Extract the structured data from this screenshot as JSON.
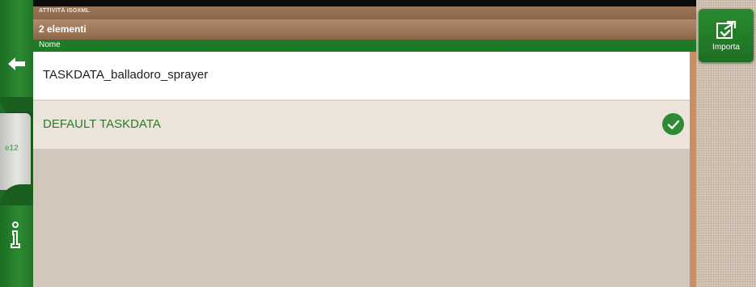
{
  "header": {
    "section_title": "ATTIVITÀ ISOXML",
    "count_text": "2 elementi",
    "column_name": "Nome"
  },
  "list": {
    "items": [
      {
        "name": "TASKDATA_balladoro_sprayer",
        "selected": false
      },
      {
        "name": "DEFAULT TASKDATA",
        "selected": true
      }
    ]
  },
  "sidebar": {
    "back_icon": "back-arrow-icon",
    "tab_label": "e12",
    "info_icon": "info-icon"
  },
  "actions": {
    "import_label": "Importa",
    "import_icon": "import-icon"
  },
  "colors": {
    "brand_green": "#1e7a24",
    "header_brown": "#9d785a",
    "selected_text": "#2b7a2e"
  }
}
